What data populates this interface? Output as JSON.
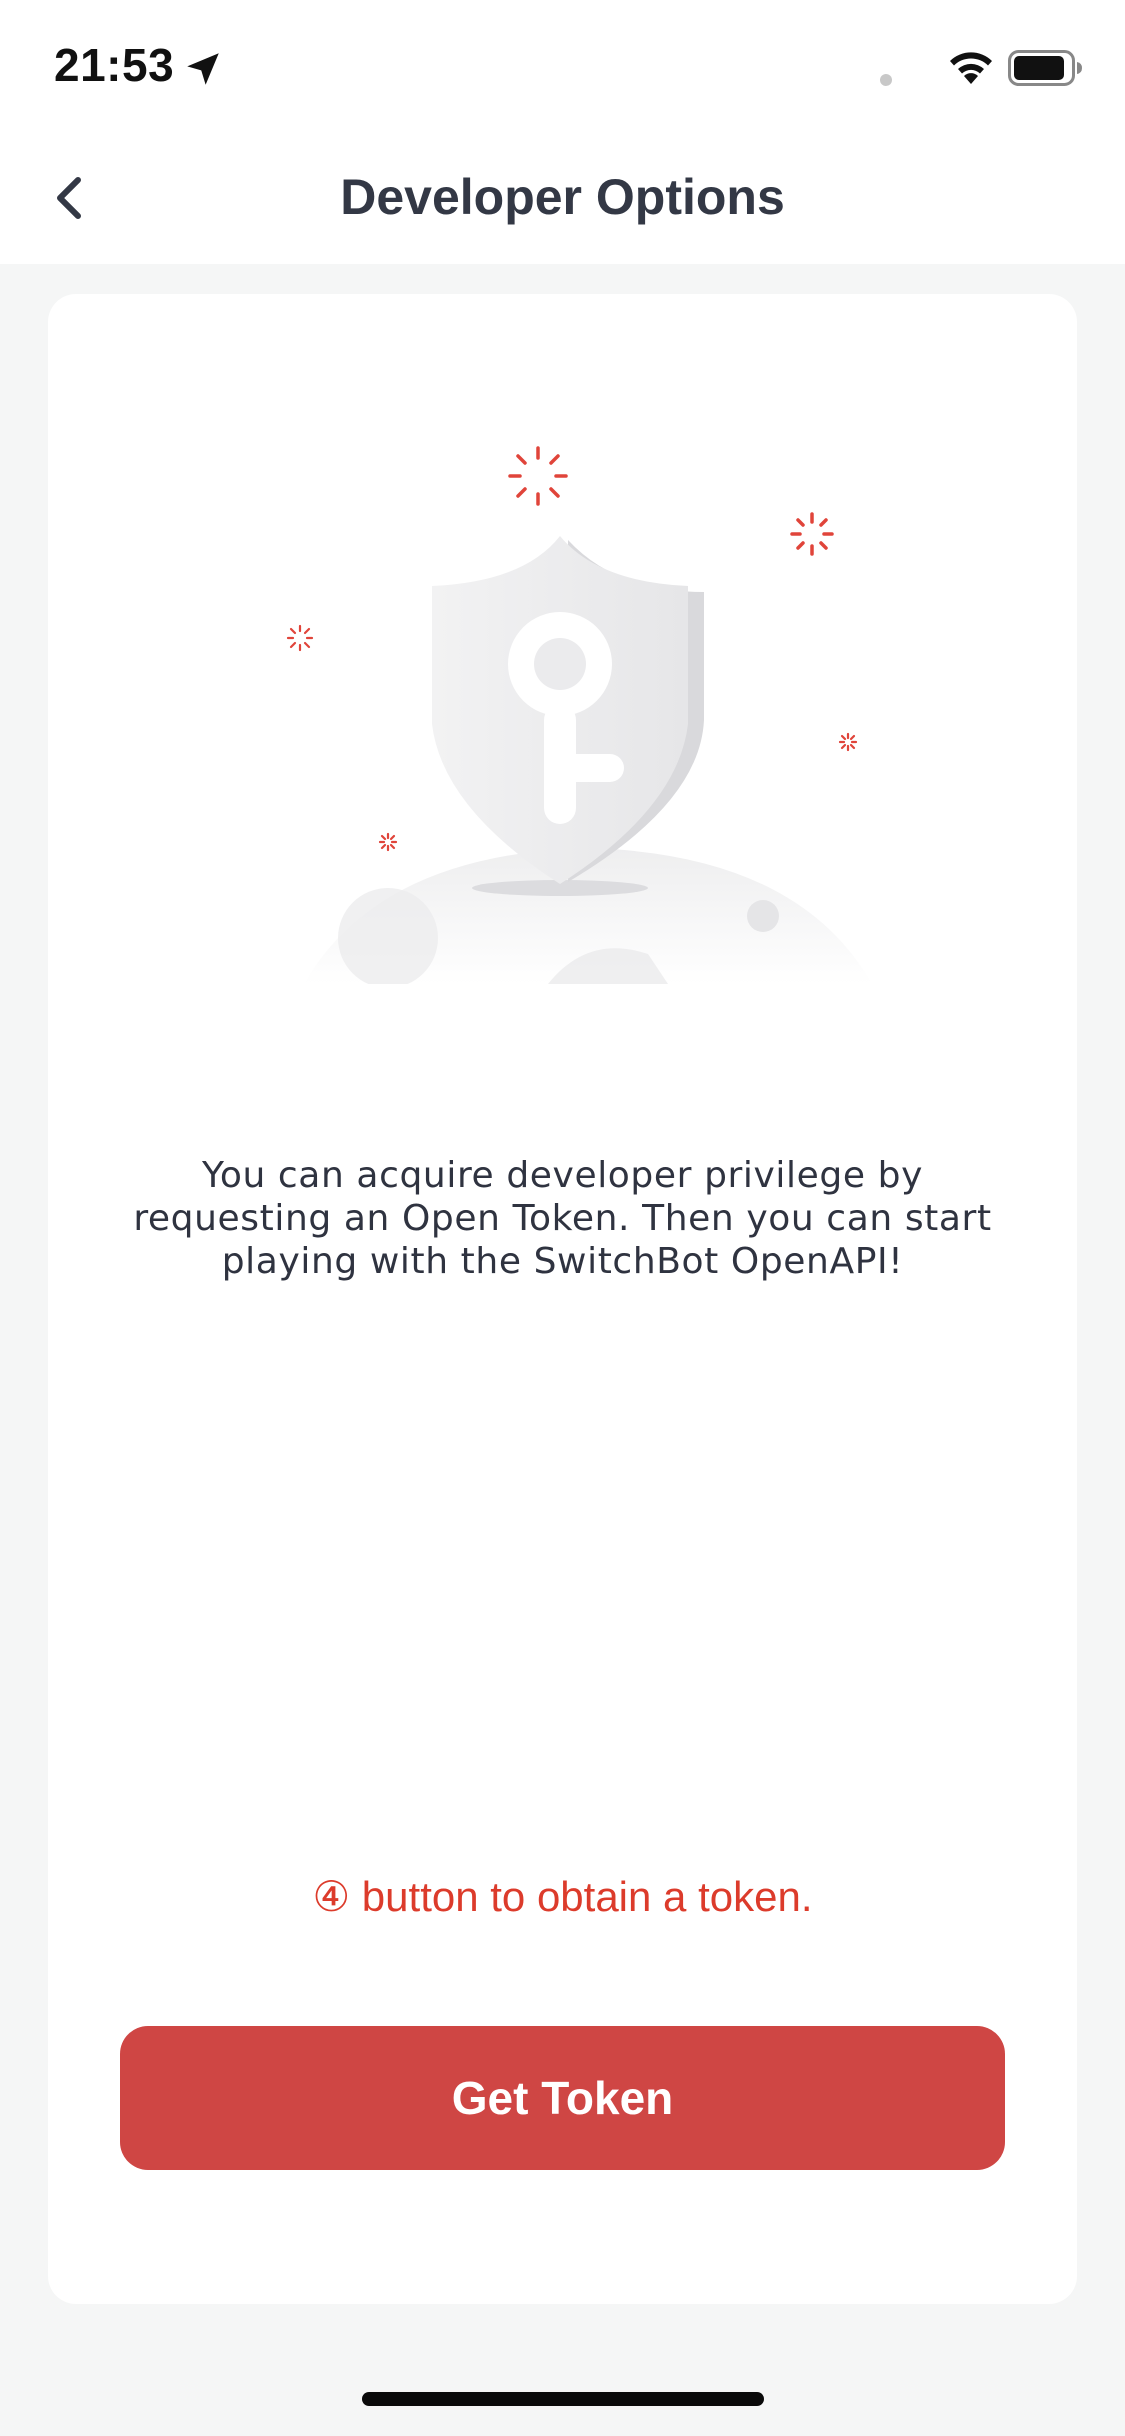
{
  "status_bar": {
    "time": "21:53",
    "icons": [
      "location-arrow-icon",
      "wifi-icon",
      "battery-icon"
    ]
  },
  "nav": {
    "title": "Developer Options",
    "back_icon": "chevron-left-icon"
  },
  "main": {
    "illustration_icon": "shield-key-icon",
    "description": "You can acquire developer privilege by requesting an Open Token. Then you can start playing with the SwitchBot OpenAPI!",
    "annotation": "④ button to obtain a token.",
    "get_token_label": "Get Token"
  },
  "colors": {
    "accent": "#cf4644",
    "annotation": "#dc3b2b",
    "background": "#f5f6f6",
    "card": "#ffffff",
    "title_text": "#333845"
  }
}
